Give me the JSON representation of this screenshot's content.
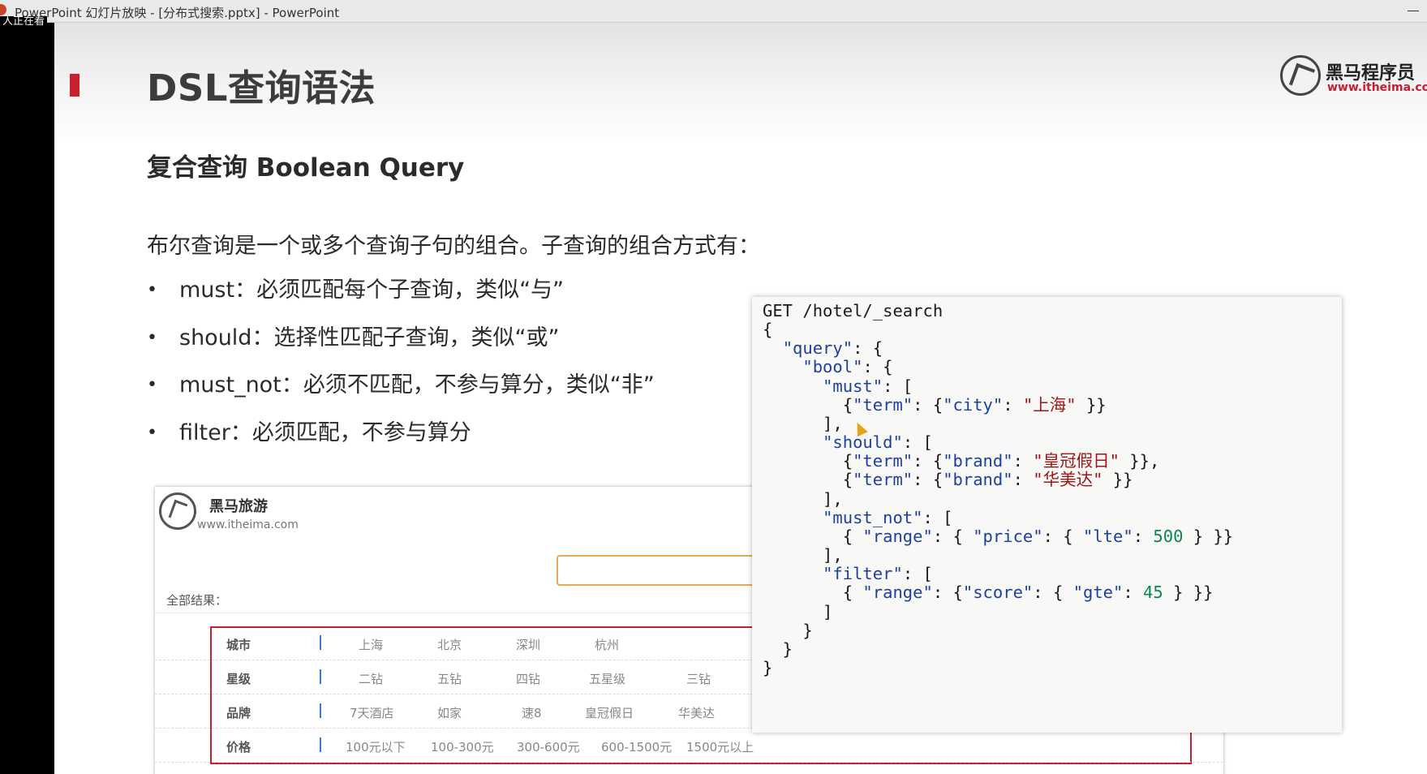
{
  "window": {
    "title": "PowerPoint 幻灯片放映 - [分布式搜索.pptx] - PowerPoint",
    "strip_label": "人正在看"
  },
  "slide": {
    "title": "DSL查询语法",
    "logo": {
      "brand": "黑马程序员",
      "url": "www.itheima.com"
    },
    "subtitle": "复合查询 Boolean Query",
    "intro": "布尔查询是一个或多个查询子句的组合。子查询的组合方式有：",
    "bullets": [
      {
        "dot": "•",
        "text": "must：必须匹配每个子查询，类似“与”"
      },
      {
        "dot": "•",
        "text": "should：选择性匹配子查询，类似“或”"
      },
      {
        "dot": "•",
        "text": "must_not：必须不匹配，不参与算分，类似“非”"
      },
      {
        "dot": "•",
        "text": "filter：必须匹配，不参与算分"
      }
    ]
  },
  "site": {
    "name": "黑马旅游",
    "url": "www.itheima.com",
    "all_results": "全部结果：",
    "filters": [
      {
        "name": "城市",
        "options": [
          "上海",
          "北京",
          "深圳",
          "杭州"
        ]
      },
      {
        "name": "星级",
        "options": [
          "二钻",
          "五钻",
          "四钻",
          "五星级",
          "三钻"
        ]
      },
      {
        "name": "品牌",
        "options": [
          "7天酒店",
          "如家",
          "速8",
          "皇冠假日",
          "华美达"
        ]
      },
      {
        "name": "价格",
        "options": [
          "100元以下",
          "100-300元",
          "300-600元",
          "600-1500元",
          "1500元以上"
        ]
      }
    ]
  },
  "code": {
    "request_line": "GET /hotel/_search",
    "lines": [
      [
        [
          "p",
          "{"
        ]
      ],
      [
        [
          "p",
          "  "
        ],
        [
          "k",
          "\"query\""
        ],
        [
          "p",
          ": {"
        ]
      ],
      [
        [
          "p",
          "    "
        ],
        [
          "k",
          "\"bool\""
        ],
        [
          "p",
          ": {"
        ]
      ],
      [
        [
          "p",
          "      "
        ],
        [
          "k",
          "\"must\""
        ],
        [
          "p",
          ": ["
        ]
      ],
      [
        [
          "p",
          "        {"
        ],
        [
          "k",
          "\"term\""
        ],
        [
          "p",
          ": {"
        ],
        [
          "k",
          "\"city\""
        ],
        [
          "p",
          ": "
        ],
        [
          "s",
          "\"上海\""
        ],
        [
          "p",
          " }}"
        ]
      ],
      [
        [
          "p",
          "      ],"
        ]
      ],
      [
        [
          "p",
          "      "
        ],
        [
          "k",
          "\"should\""
        ],
        [
          "p",
          ": ["
        ]
      ],
      [
        [
          "p",
          "        {"
        ],
        [
          "k",
          "\"term\""
        ],
        [
          "p",
          ": {"
        ],
        [
          "k",
          "\"brand\""
        ],
        [
          "p",
          ": "
        ],
        [
          "s",
          "\"皇冠假日\""
        ],
        [
          "p",
          " }},"
        ]
      ],
      [
        [
          "p",
          "        {"
        ],
        [
          "k",
          "\"term\""
        ],
        [
          "p",
          ": {"
        ],
        [
          "k",
          "\"brand\""
        ],
        [
          "p",
          ": "
        ],
        [
          "s",
          "\"华美达\""
        ],
        [
          "p",
          " }}"
        ]
      ],
      [
        [
          "p",
          "      ],"
        ]
      ],
      [
        [
          "p",
          "      "
        ],
        [
          "k",
          "\"must_not\""
        ],
        [
          "p",
          ": ["
        ]
      ],
      [
        [
          "p",
          "        { "
        ],
        [
          "k",
          "\"range\""
        ],
        [
          "p",
          ": { "
        ],
        [
          "k",
          "\"price\""
        ],
        [
          "p",
          ": { "
        ],
        [
          "k",
          "\"lte\""
        ],
        [
          "p",
          ": "
        ],
        [
          "n",
          "500"
        ],
        [
          "p",
          " } }}"
        ]
      ],
      [
        [
          "p",
          "      ],"
        ]
      ],
      [
        [
          "p",
          "      "
        ],
        [
          "k",
          "\"filter\""
        ],
        [
          "p",
          ": ["
        ]
      ],
      [
        [
          "p",
          "        { "
        ],
        [
          "k",
          "\"range\""
        ],
        [
          "p",
          ": {"
        ],
        [
          "k",
          "\"score\""
        ],
        [
          "p",
          ": { "
        ],
        [
          "k",
          "\"gte\""
        ],
        [
          "p",
          ": "
        ],
        [
          "n",
          "45"
        ],
        [
          "p",
          " } }}"
        ]
      ],
      [
        [
          "p",
          "      ]"
        ]
      ],
      [
        [
          "p",
          "    }"
        ]
      ],
      [
        [
          "p",
          "  }"
        ]
      ],
      [
        [
          "p",
          "}"
        ]
      ]
    ]
  },
  "colors": {
    "accent": "#c8202f",
    "code_key": "#1d3fa0",
    "code_string": "#a31515",
    "code_number": "#098658",
    "search_border": "#e8a95a"
  }
}
